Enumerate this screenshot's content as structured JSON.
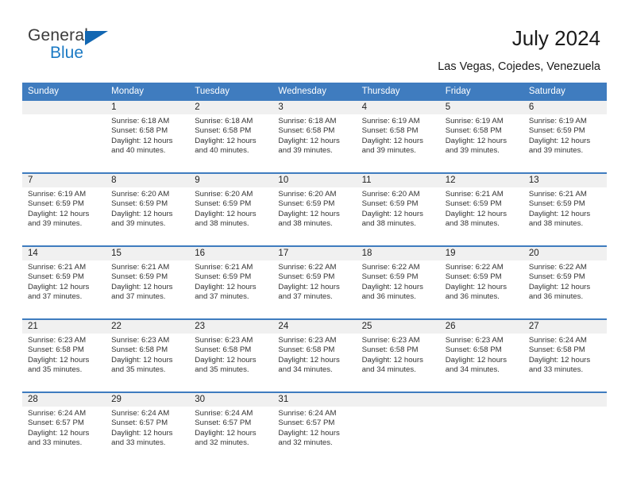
{
  "brand": {
    "name_part1": "General",
    "name_part2": "Blue",
    "accent_color": "#1b7ac4",
    "triangle_color": "#1267b2"
  },
  "header": {
    "title": "July 2024",
    "subtitle": "Las Vegas, Cojedes, Venezuela",
    "header_bg_color": "#3f7cbf",
    "daynum_band_color": "#f0f0f0"
  },
  "weekdays": [
    "Sunday",
    "Monday",
    "Tuesday",
    "Wednesday",
    "Thursday",
    "Friday",
    "Saturday"
  ],
  "labels": {
    "sunrise_prefix": "Sunrise: ",
    "sunset_prefix": "Sunset: ",
    "daylight_prefix": "Daylight: "
  },
  "weeks": [
    [
      {
        "day": "",
        "empty": true
      },
      {
        "day": "1",
        "sunrise": "Sunrise: 6:18 AM",
        "sunset": "Sunset: 6:58 PM",
        "daylight_line1": "Daylight: 12 hours",
        "daylight_line2": "and 40 minutes."
      },
      {
        "day": "2",
        "sunrise": "Sunrise: 6:18 AM",
        "sunset": "Sunset: 6:58 PM",
        "daylight_line1": "Daylight: 12 hours",
        "daylight_line2": "and 40 minutes."
      },
      {
        "day": "3",
        "sunrise": "Sunrise: 6:18 AM",
        "sunset": "Sunset: 6:58 PM",
        "daylight_line1": "Daylight: 12 hours",
        "daylight_line2": "and 39 minutes."
      },
      {
        "day": "4",
        "sunrise": "Sunrise: 6:19 AM",
        "sunset": "Sunset: 6:58 PM",
        "daylight_line1": "Daylight: 12 hours",
        "daylight_line2": "and 39 minutes."
      },
      {
        "day": "5",
        "sunrise": "Sunrise: 6:19 AM",
        "sunset": "Sunset: 6:58 PM",
        "daylight_line1": "Daylight: 12 hours",
        "daylight_line2": "and 39 minutes."
      },
      {
        "day": "6",
        "sunrise": "Sunrise: 6:19 AM",
        "sunset": "Sunset: 6:59 PM",
        "daylight_line1": "Daylight: 12 hours",
        "daylight_line2": "and 39 minutes."
      }
    ],
    [
      {
        "day": "7",
        "sunrise": "Sunrise: 6:19 AM",
        "sunset": "Sunset: 6:59 PM",
        "daylight_line1": "Daylight: 12 hours",
        "daylight_line2": "and 39 minutes."
      },
      {
        "day": "8",
        "sunrise": "Sunrise: 6:20 AM",
        "sunset": "Sunset: 6:59 PM",
        "daylight_line1": "Daylight: 12 hours",
        "daylight_line2": "and 39 minutes."
      },
      {
        "day": "9",
        "sunrise": "Sunrise: 6:20 AM",
        "sunset": "Sunset: 6:59 PM",
        "daylight_line1": "Daylight: 12 hours",
        "daylight_line2": "and 38 minutes."
      },
      {
        "day": "10",
        "sunrise": "Sunrise: 6:20 AM",
        "sunset": "Sunset: 6:59 PM",
        "daylight_line1": "Daylight: 12 hours",
        "daylight_line2": "and 38 minutes."
      },
      {
        "day": "11",
        "sunrise": "Sunrise: 6:20 AM",
        "sunset": "Sunset: 6:59 PM",
        "daylight_line1": "Daylight: 12 hours",
        "daylight_line2": "and 38 minutes."
      },
      {
        "day": "12",
        "sunrise": "Sunrise: 6:21 AM",
        "sunset": "Sunset: 6:59 PM",
        "daylight_line1": "Daylight: 12 hours",
        "daylight_line2": "and 38 minutes."
      },
      {
        "day": "13",
        "sunrise": "Sunrise: 6:21 AM",
        "sunset": "Sunset: 6:59 PM",
        "daylight_line1": "Daylight: 12 hours",
        "daylight_line2": "and 38 minutes."
      }
    ],
    [
      {
        "day": "14",
        "sunrise": "Sunrise: 6:21 AM",
        "sunset": "Sunset: 6:59 PM",
        "daylight_line1": "Daylight: 12 hours",
        "daylight_line2": "and 37 minutes."
      },
      {
        "day": "15",
        "sunrise": "Sunrise: 6:21 AM",
        "sunset": "Sunset: 6:59 PM",
        "daylight_line1": "Daylight: 12 hours",
        "daylight_line2": "and 37 minutes."
      },
      {
        "day": "16",
        "sunrise": "Sunrise: 6:21 AM",
        "sunset": "Sunset: 6:59 PM",
        "daylight_line1": "Daylight: 12 hours",
        "daylight_line2": "and 37 minutes."
      },
      {
        "day": "17",
        "sunrise": "Sunrise: 6:22 AM",
        "sunset": "Sunset: 6:59 PM",
        "daylight_line1": "Daylight: 12 hours",
        "daylight_line2": "and 37 minutes."
      },
      {
        "day": "18",
        "sunrise": "Sunrise: 6:22 AM",
        "sunset": "Sunset: 6:59 PM",
        "daylight_line1": "Daylight: 12 hours",
        "daylight_line2": "and 36 minutes."
      },
      {
        "day": "19",
        "sunrise": "Sunrise: 6:22 AM",
        "sunset": "Sunset: 6:59 PM",
        "daylight_line1": "Daylight: 12 hours",
        "daylight_line2": "and 36 minutes."
      },
      {
        "day": "20",
        "sunrise": "Sunrise: 6:22 AM",
        "sunset": "Sunset: 6:59 PM",
        "daylight_line1": "Daylight: 12 hours",
        "daylight_line2": "and 36 minutes."
      }
    ],
    [
      {
        "day": "21",
        "sunrise": "Sunrise: 6:23 AM",
        "sunset": "Sunset: 6:58 PM",
        "daylight_line1": "Daylight: 12 hours",
        "daylight_line2": "and 35 minutes."
      },
      {
        "day": "22",
        "sunrise": "Sunrise: 6:23 AM",
        "sunset": "Sunset: 6:58 PM",
        "daylight_line1": "Daylight: 12 hours",
        "daylight_line2": "and 35 minutes."
      },
      {
        "day": "23",
        "sunrise": "Sunrise: 6:23 AM",
        "sunset": "Sunset: 6:58 PM",
        "daylight_line1": "Daylight: 12 hours",
        "daylight_line2": "and 35 minutes."
      },
      {
        "day": "24",
        "sunrise": "Sunrise: 6:23 AM",
        "sunset": "Sunset: 6:58 PM",
        "daylight_line1": "Daylight: 12 hours",
        "daylight_line2": "and 34 minutes."
      },
      {
        "day": "25",
        "sunrise": "Sunrise: 6:23 AM",
        "sunset": "Sunset: 6:58 PM",
        "daylight_line1": "Daylight: 12 hours",
        "daylight_line2": "and 34 minutes."
      },
      {
        "day": "26",
        "sunrise": "Sunrise: 6:23 AM",
        "sunset": "Sunset: 6:58 PM",
        "daylight_line1": "Daylight: 12 hours",
        "daylight_line2": "and 34 minutes."
      },
      {
        "day": "27",
        "sunrise": "Sunrise: 6:24 AM",
        "sunset": "Sunset: 6:58 PM",
        "daylight_line1": "Daylight: 12 hours",
        "daylight_line2": "and 33 minutes."
      }
    ],
    [
      {
        "day": "28",
        "sunrise": "Sunrise: 6:24 AM",
        "sunset": "Sunset: 6:57 PM",
        "daylight_line1": "Daylight: 12 hours",
        "daylight_line2": "and 33 minutes."
      },
      {
        "day": "29",
        "sunrise": "Sunrise: 6:24 AM",
        "sunset": "Sunset: 6:57 PM",
        "daylight_line1": "Daylight: 12 hours",
        "daylight_line2": "and 33 minutes."
      },
      {
        "day": "30",
        "sunrise": "Sunrise: 6:24 AM",
        "sunset": "Sunset: 6:57 PM",
        "daylight_line1": "Daylight: 12 hours",
        "daylight_line2": "and 32 minutes."
      },
      {
        "day": "31",
        "sunrise": "Sunrise: 6:24 AM",
        "sunset": "Sunset: 6:57 PM",
        "daylight_line1": "Daylight: 12 hours",
        "daylight_line2": "and 32 minutes."
      },
      {
        "day": "",
        "empty": true
      },
      {
        "day": "",
        "empty": true
      },
      {
        "day": "",
        "empty": true
      }
    ]
  ]
}
